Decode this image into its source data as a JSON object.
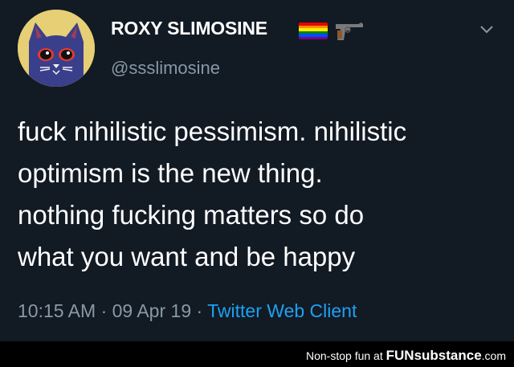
{
  "tweet": {
    "display_name": "ROXY SLIMOSINE",
    "handle": "@ssslimosine",
    "avatar": {
      "icon": "cat-avatar-icon",
      "colors": [
        "#e6cf74",
        "#3a3f8c",
        "#e63b2e"
      ]
    },
    "badges": [
      {
        "icon": "rainbow-flag-icon"
      },
      {
        "icon": "gun-icon"
      }
    ],
    "menu_icon": "chevron-down-icon",
    "lines": [
      "fuck nihilistic pessimism. nihilistic",
      "optimism is the new thing.",
      "nothing fucking matters so do",
      "what you want and be happy"
    ],
    "time": "10:15 AM",
    "separator": "·",
    "date": "09 Apr 19",
    "source": "Twitter Web Client",
    "colors": {
      "background": "#121a24",
      "secondary_text": "#8899a6",
      "link": "#1da1f2"
    }
  },
  "footer": {
    "prefix": "Non-stop fun at",
    "brand": "FUNsubstance",
    "suffix": ".com"
  }
}
